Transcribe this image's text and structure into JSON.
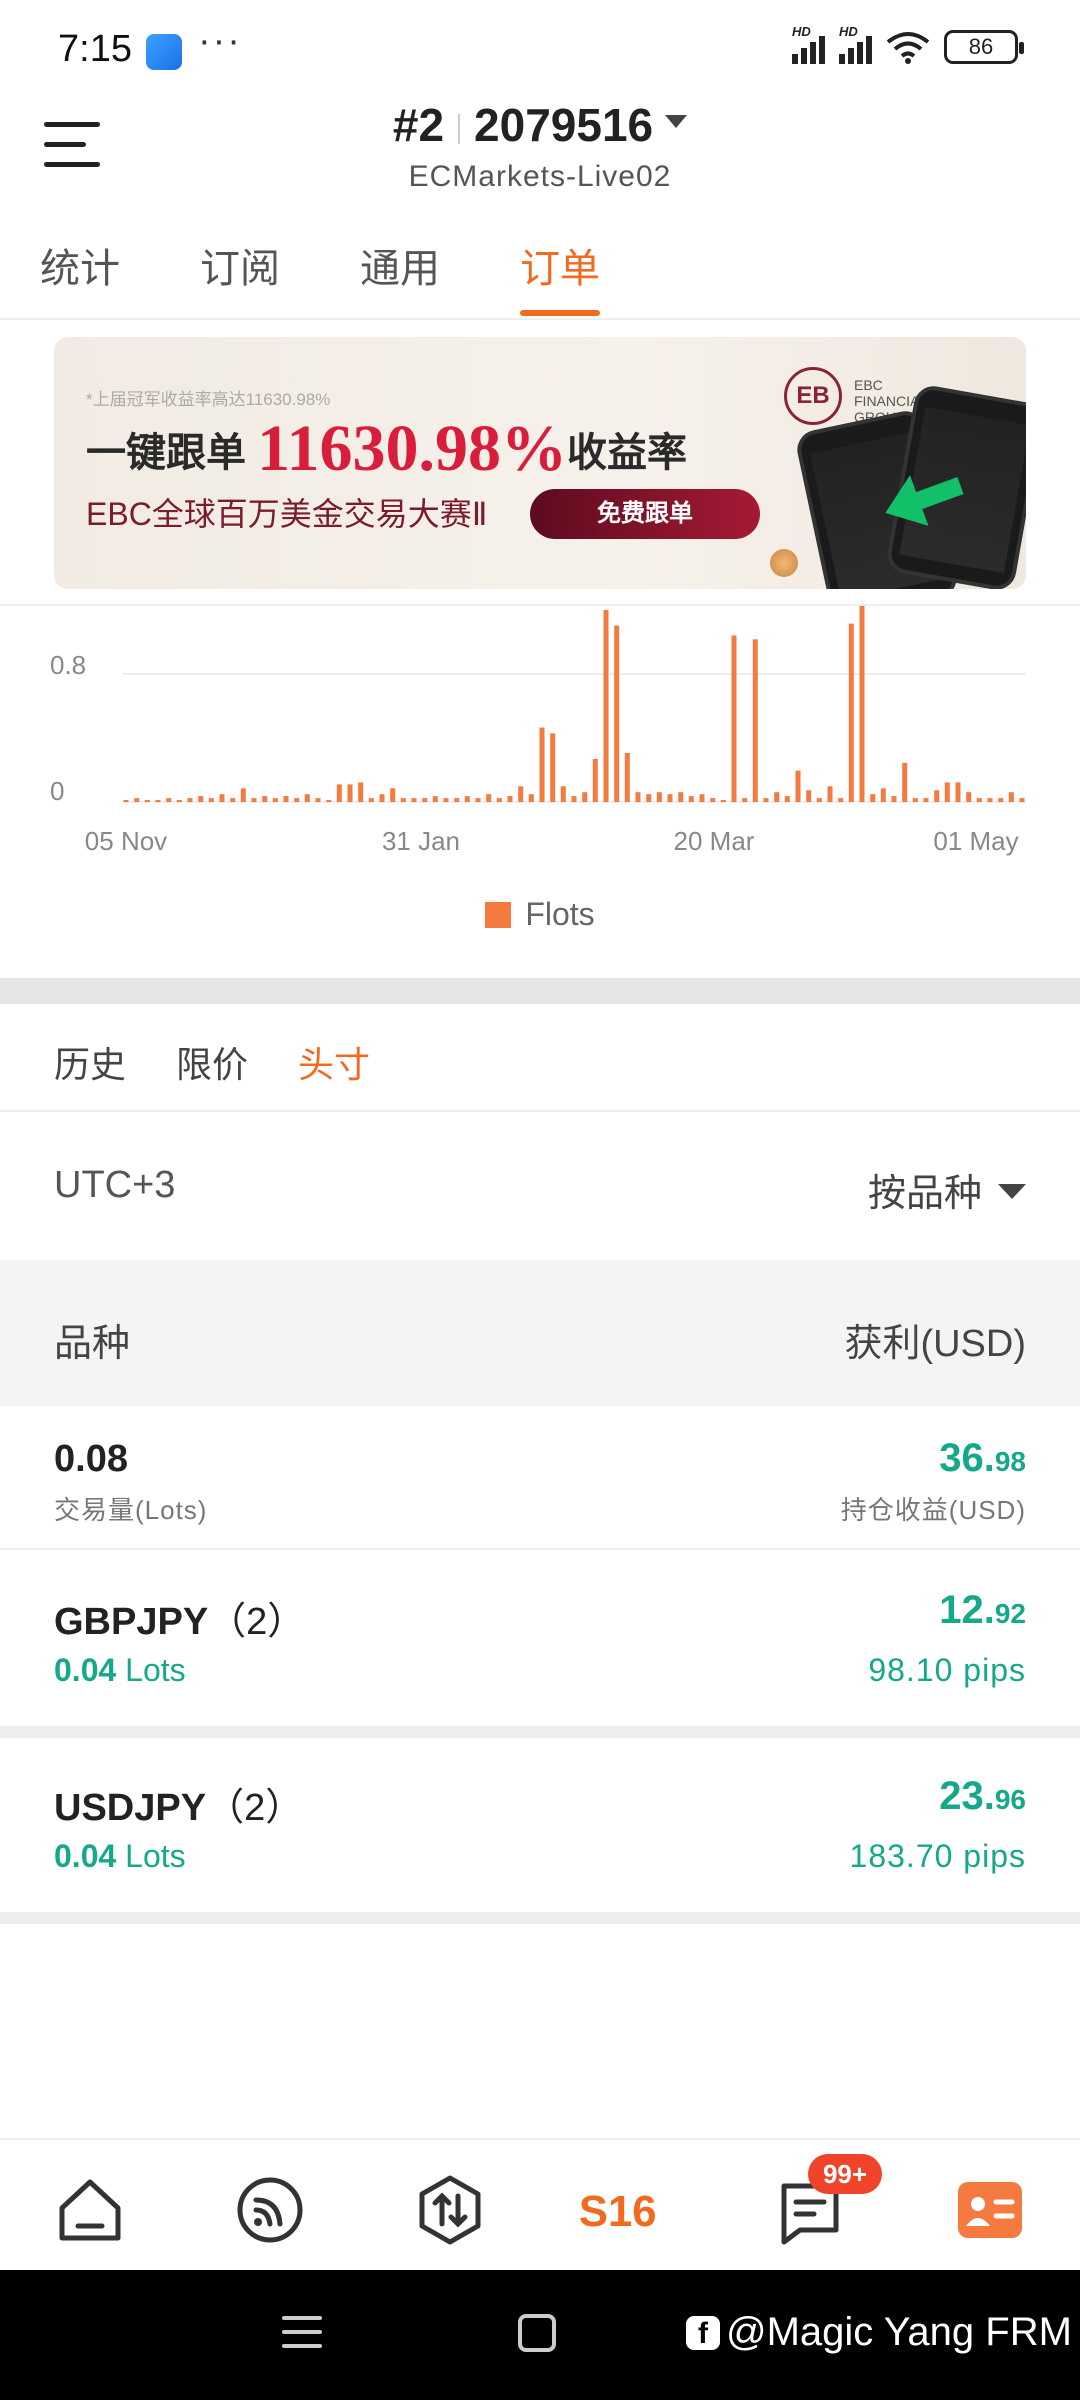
{
  "status_bar": {
    "time": "7:15",
    "dots": "···",
    "signal1_label": "HD",
    "signal2_label": "HD",
    "battery": "86"
  },
  "header": {
    "account_index": "#2",
    "account_number": "2079516",
    "server": "ECMarkets-Live02"
  },
  "tabs": [
    {
      "label": "统计",
      "active": false
    },
    {
      "label": "订阅",
      "active": false
    },
    {
      "label": "通用",
      "active": false
    },
    {
      "label": "订单",
      "active": true
    }
  ],
  "banner": {
    "note": "*上届冠军收益率高达11630.98%",
    "head_prefix": "一键跟单",
    "head_value": "11630.98%",
    "head_suffix": "收益率",
    "subtitle": "EBC全球百万美金交易大赛Ⅱ",
    "cta": "免费跟单",
    "logo_text": "EBC FINANCIAL GROUP"
  },
  "chart_data": {
    "type": "bar",
    "x_tick_labels": [
      "05 Nov",
      "31 Jan",
      "20 Mar",
      "01 May"
    ],
    "y_tick_labels": [
      "0.8",
      "0"
    ],
    "ylim": [
      0,
      1.0
    ],
    "series": [
      {
        "name": "Flots",
        "color": "#f47a3f",
        "values": [
          0.01,
          0.02,
          0.01,
          0.01,
          0.02,
          0.01,
          0.02,
          0.03,
          0.02,
          0.04,
          0.02,
          0.07,
          0.02,
          0.03,
          0.02,
          0.03,
          0.02,
          0.04,
          0.02,
          0.01,
          0.09,
          0.09,
          0.1,
          0.02,
          0.04,
          0.07,
          0.02,
          0.02,
          0.02,
          0.03,
          0.02,
          0.02,
          0.03,
          0.02,
          0.04,
          0.02,
          0.03,
          0.08,
          0.04,
          0.38,
          0.35,
          0.08,
          0.03,
          0.05,
          0.22,
          0.98,
          0.9,
          0.25,
          0.05,
          0.04,
          0.05,
          0.04,
          0.05,
          0.03,
          0.04,
          0.02,
          0.01,
          0.85,
          0.02,
          0.83,
          0.02,
          0.05,
          0.03,
          0.16,
          0.06,
          0.02,
          0.08,
          0.02,
          0.91,
          1.0,
          0.04,
          0.07,
          0.03,
          0.2,
          0.02,
          0.02,
          0.06,
          0.1,
          0.1,
          0.05,
          0.02,
          0.02,
          0.02,
          0.05,
          0.02
        ]
      }
    ]
  },
  "subtabs": [
    {
      "label": "历史",
      "active": false
    },
    {
      "label": "限价",
      "active": false
    },
    {
      "label": "头寸",
      "active": true
    }
  ],
  "filters": {
    "timezone": "UTC+3",
    "sort": "按品种"
  },
  "table_header": {
    "symbol": "品种",
    "profit": "获利(USD)"
  },
  "summary": {
    "volume": "0.08",
    "volume_label": "交易量(Lots)",
    "pnl_int": "36.",
    "pnl_dec": "98",
    "pnl_label": "持仓收益(USD)"
  },
  "positions": [
    {
      "symbol": "GBPJPY",
      "count": "（2）",
      "lots_value": "0.04",
      "lots_unit": " Lots",
      "pnl_int": "12.",
      "pnl_dec": "92",
      "pips": "98.10 pips"
    },
    {
      "symbol": "USDJPY",
      "count": "（2）",
      "lots_value": "0.04",
      "lots_unit": " Lots",
      "pnl_int": "23.",
      "pnl_dec": "96",
      "pips": "183.70 pips"
    }
  ],
  "bottom_nav": {
    "s16_label": "S16",
    "badge": "99+",
    "accent": "#f06b1f"
  },
  "watermark": "@Magic Yang FRM"
}
